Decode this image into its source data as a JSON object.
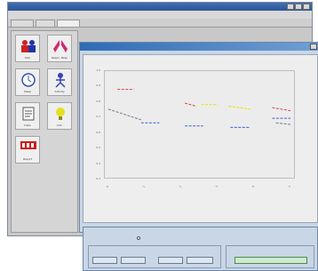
{
  "colors": {
    "title_bar": "#2c5596",
    "dialog_title": "#2e6bb4",
    "dialog_bg": "#c9d6e6",
    "series_red": "#e04040",
    "series_yellow": "#e8e000",
    "series_blue": "#3f5fd0",
    "series_gray": "#7a7a7a"
  },
  "sidebar": {
    "tiles": [
      {
        "icon": "people-group-icon",
        "label": "Task"
      },
      {
        "icon": "lungs-icon",
        "label": "Respir. Resp"
      },
      {
        "icon": "clock-icon",
        "label": "Sleep"
      },
      {
        "icon": "person-icon",
        "label": "Activity"
      },
      {
        "icon": "document-icon",
        "label": "Data"
      },
      {
        "icon": "lightbulb-icon",
        "label": "Info"
      },
      {
        "icon": "logo-icon",
        "label": "Report"
      }
    ]
  },
  "chart_data": {
    "type": "line",
    "y_ticks": [
      "1.0",
      "0.9",
      "0.8",
      "0.7",
      "0.6",
      "0.5",
      "0.4",
      "0.3"
    ],
    "ylim": [
      0.3,
      1.0
    ],
    "x": [
      0,
      1,
      2,
      3,
      4,
      5
    ],
    "grid": false,
    "legend": "none",
    "series": [
      {
        "color": "#e04040",
        "segments": [
          [
            [
              0.25,
              0.88
            ],
            [
              0.7,
              0.88
            ]
          ],
          [
            [
              2.1,
              0.79
            ],
            [
              2.4,
              0.77
            ]
          ],
          [
            [
              4.5,
              0.76
            ],
            [
              5.0,
              0.74
            ]
          ]
        ]
      },
      {
        "color": "#e8e000",
        "segments": [
          [
            [
              2.55,
              0.78
            ],
            [
              3.0,
              0.78
            ]
          ],
          [
            [
              3.3,
              0.77
            ],
            [
              3.9,
              0.75
            ]
          ]
        ]
      },
      {
        "color": "#3f5fd0",
        "segments": [
          [
            [
              0.9,
              0.66
            ],
            [
              1.4,
              0.66
            ]
          ],
          [
            [
              2.1,
              0.64
            ],
            [
              2.6,
              0.64
            ]
          ],
          [
            [
              3.35,
              0.63
            ],
            [
              3.9,
              0.63
            ]
          ],
          [
            [
              4.5,
              0.69
            ],
            [
              5.0,
              0.69
            ]
          ]
        ]
      },
      {
        "color": "#7a7a7a",
        "segments": [
          [
            [
              0.0,
              0.75
            ],
            [
              0.9,
              0.68
            ]
          ],
          [
            [
              4.6,
              0.66
            ],
            [
              5.0,
              0.65
            ]
          ]
        ]
      }
    ]
  },
  "controls": {
    "buttons": [
      {
        "name": "control-button-1"
      },
      {
        "name": "control-button-2"
      },
      {
        "name": "control-button-3"
      },
      {
        "name": "control-button-4"
      },
      {
        "name": "control-button-5"
      }
    ]
  }
}
